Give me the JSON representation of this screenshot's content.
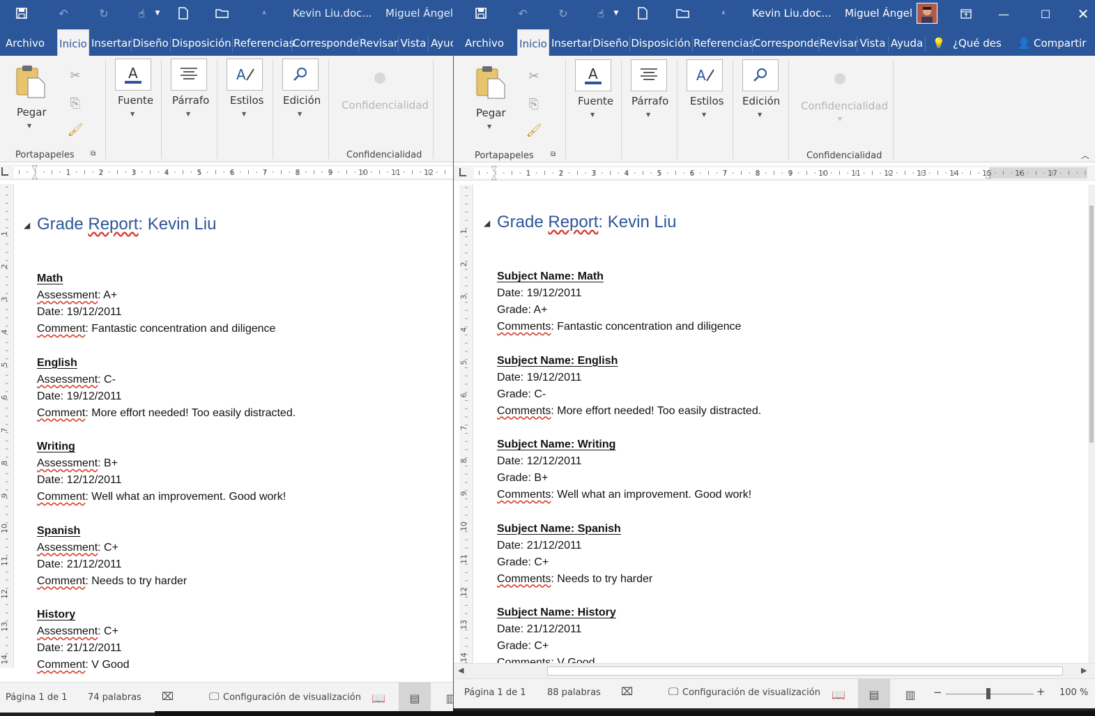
{
  "left": {
    "title": "Kevin Liu.doc...",
    "user": "Miguel Ángel",
    "tabs": [
      "Archivo",
      "Inicio",
      "Insertar",
      "Diseño",
      "Disposición",
      "Referencias",
      "Corresponde",
      "Revisar",
      "Vista",
      "Ayuc"
    ],
    "ribbon": {
      "pegar": "Pegar",
      "portapapeles": "Portapapeles",
      "fuente": "Fuente",
      "parrafo": "Párrafo",
      "estilos": "Estilos",
      "edicion": "Edición",
      "confidencialidad_btn": "Confidencialidad",
      "confidencialidad_group": "Confidencialidad"
    },
    "ruler_numbers": [
      "1",
      "2",
      "3",
      "4",
      "5",
      "6",
      "7",
      "8",
      "9",
      "10",
      "11",
      "12"
    ],
    "vruler_numbers": [
      "1",
      "2",
      "3",
      "4",
      "5",
      "6",
      "7",
      "8",
      "9",
      "10",
      "11",
      "12",
      "13",
      "14"
    ],
    "doc": {
      "heading": {
        "pre": "Grade ",
        "sq": "Report",
        "post": ": Kevin Liu"
      },
      "subjects": [
        {
          "name": "Math",
          "l1k": "Assessment",
          "l1v": ": A+",
          "l2": "Date: 19/12/2011",
          "l3k": "Comment",
          "l3v": ": Fantastic concentration and diligence"
        },
        {
          "name": "English",
          "l1k": "Assessment",
          "l1v": ": C-",
          "l2": "Date: 19/12/2011",
          "l3k": "Comment",
          "l3v": ": More effort needed! Too easily distracted."
        },
        {
          "name": "Writing",
          "l1k": "Assessment",
          "l1v": ": B+",
          "l2": "Date: 12/12/2011",
          "l3k": "Comment",
          "l3v": ": Well what an improvement. Good work!"
        },
        {
          "name": "Spanish",
          "l1k": "Assessment",
          "l1v": ": C+",
          "l2": "Date: 21/12/2011",
          "l3k": "Comment",
          "l3v": ": Needs to try harder"
        },
        {
          "name": "History",
          "l1k": "Assessment",
          "l1v": ": C+",
          "l2": "Date: 21/12/2011",
          "l3k": "Comment",
          "l3v": ": V Good"
        }
      ]
    },
    "status": {
      "page": "Página 1 de 1",
      "words": "74 palabras",
      "display": "Configuración de visualización"
    }
  },
  "right": {
    "title": "Kevin Liu.doc...",
    "user": "Miguel Ángel",
    "tabs": [
      "Archivo",
      "Inicio",
      "Insertar",
      "Diseño",
      "Disposición",
      "Referencias",
      "Corresponde",
      "Revisar",
      "Vista",
      "Ayuda"
    ],
    "tell_me": "¿Qué des",
    "share": "Compartir",
    "ribbon": {
      "pegar": "Pegar",
      "portapapeles": "Portapapeles",
      "fuente": "Fuente",
      "parrafo": "Párrafo",
      "estilos": "Estilos",
      "edicion": "Edición",
      "confidencialidad_btn": "Confidencialidad",
      "confidencialidad_group": "Confidencialidad"
    },
    "ruler_numbers": [
      "1",
      "2",
      "3",
      "4",
      "5",
      "6",
      "7",
      "8",
      "9",
      "10",
      "11",
      "12",
      "13",
      "14",
      "15",
      "16",
      "17"
    ],
    "vruler_numbers": [
      "1",
      "2",
      "3",
      "4",
      "5",
      "6",
      "7",
      "8",
      "9",
      "10",
      "11",
      "12",
      "13",
      "14"
    ],
    "doc": {
      "heading": {
        "pre": "Grade ",
        "sq": "Report",
        "post": ": Kevin Liu"
      },
      "subjects": [
        {
          "name": "Subject Name: Math",
          "l1": "Date: 19/12/2011",
          "l2": "Grade: A+",
          "l3k": "Comments",
          "l3v": ": Fantastic concentration and diligence"
        },
        {
          "name": "Subject Name: English",
          "l1": "Date: 19/12/2011",
          "l2": "Grade: C-",
          "l3k": "Comments",
          "l3v": ": More effort needed! Too easily distracted."
        },
        {
          "name": "Subject Name: Writing",
          "l1": "Date: 12/12/2011",
          "l2": "Grade: B+",
          "l3k": "Comments",
          "l3v": ": Well what an improvement. Good work!"
        },
        {
          "name": "Subject Name: Spanish",
          "l1": "Date: 21/12/2011",
          "l2": "Grade: C+",
          "l3k": "Comments",
          "l3v": ": Needs to try harder"
        },
        {
          "name": "Subject Name: History",
          "l1": "Date: 21/12/2011",
          "l2": "Grade: C+",
          "l3k": "Comments",
          "l3v": ": V Good"
        }
      ]
    },
    "status": {
      "page": "Página 1 de 1",
      "words": "88 palabras",
      "display": "Configuración de visualización",
      "zoom": "100 %"
    }
  },
  "colors": {
    "title_bar": "#2b579a",
    "heading": "#2e5597",
    "ribbon_bg": "#f3f3f3"
  }
}
